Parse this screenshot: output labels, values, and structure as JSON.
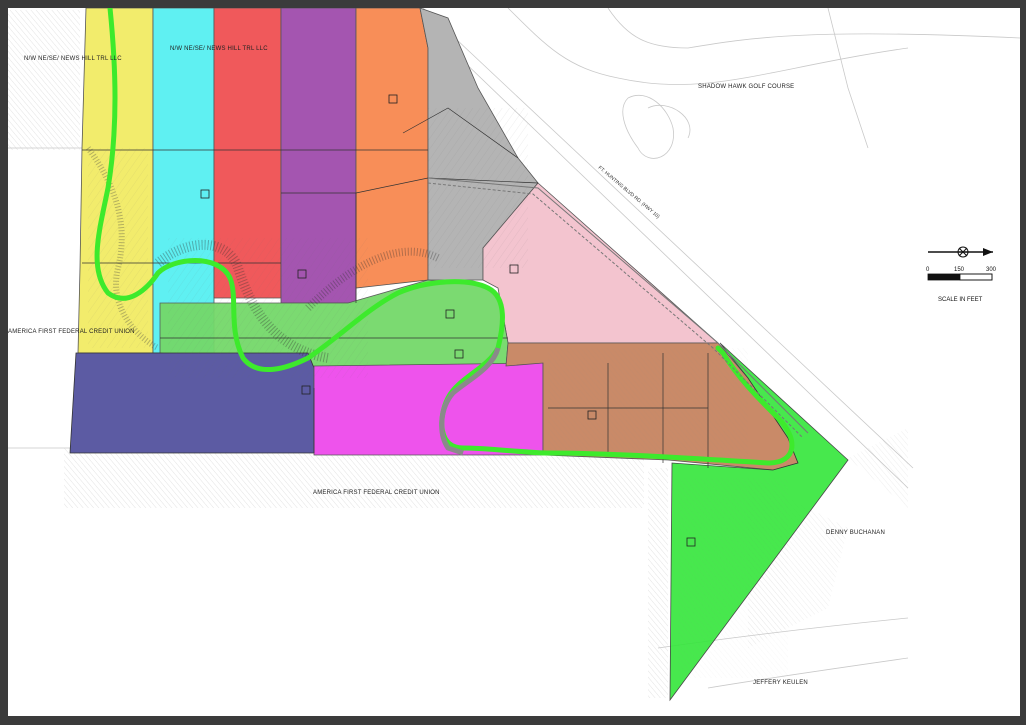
{
  "map": {
    "labels": {
      "nw_owner": "N/W NE/SE/ NEWS HILL TRL LLC",
      "nw_owner2": "N/W NE/SE/ NEWS HILL TRL LLC",
      "golf": "SHADOW HAWK GOLF COURSE",
      "credit_union_w": "AMERICA FIRST FEDERAL CREDIT UNION",
      "credit_union_s": "AMERICA FIRST FEDERAL CREDIT UNION",
      "road": "FT. HUNTING BLVD RD. (HWY 10)",
      "owner_se": "DENNY BUCHANAN",
      "owner_s": "JEFFERY KEULEN"
    },
    "scale": {
      "ticks": [
        "0",
        "150",
        "300"
      ],
      "caption": "SCALE IN FEET"
    },
    "colors": {
      "yellow": "#f2ec6c",
      "cyan": "#5ff0f2",
      "red": "#f0595b",
      "purple": "#a455b0",
      "orange": "#f88e58",
      "gray": "#b4b4b4",
      "pink": "#f3c4cf",
      "brown": "#c98a68",
      "green": "#74d86a",
      "bright_green": "#33e63a",
      "navy": "#5c5ba3",
      "magenta": "#ee53ec",
      "route_green": "#3dea2c",
      "route_gray": "#8a8a8a"
    }
  }
}
